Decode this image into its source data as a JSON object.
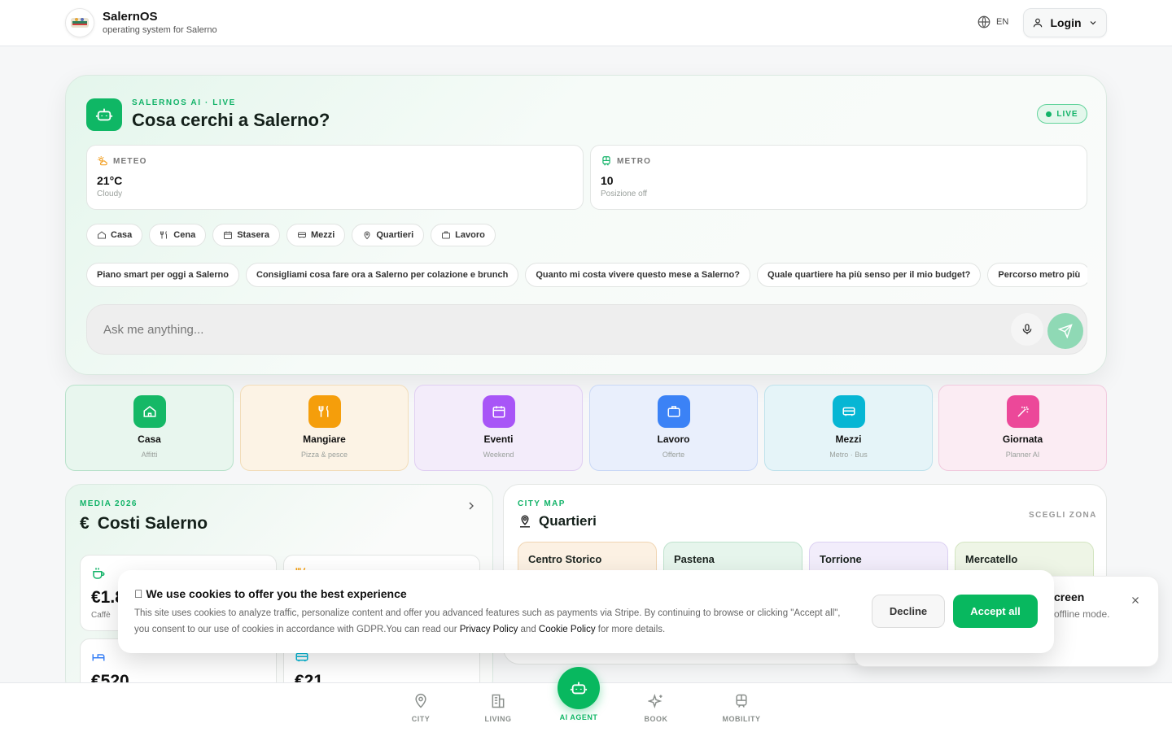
{
  "header": {
    "brand_name": "SalernOS",
    "brand_sub": "operating system for Salerno",
    "lang": "EN",
    "login_label": "Login"
  },
  "hero": {
    "kicker": "SALERNOS AI · LIVE",
    "title": "Cosa cerchi a Salerno?",
    "live_label": "LIVE",
    "weather": {
      "label": "METEO",
      "value": "21°C",
      "sub": "Cloudy"
    },
    "metro": {
      "label": "METRO",
      "value": "10",
      "sub": "Posizione off"
    },
    "chips": [
      "Casa",
      "Cena",
      "Stasera",
      "Mezzi",
      "Quartieri",
      "Lavoro"
    ],
    "suggestions": [
      "Piano smart per oggi a Salerno",
      "Consigliami cosa fare ora a Salerno per colazione e brunch",
      "Quanto mi costa vivere questo mese a Salerno?",
      "Quale quartiere ha più senso per il mio budget?",
      "Percorso metro più"
    ],
    "ask_placeholder": "Ask me anything..."
  },
  "categories": [
    {
      "title": "Casa",
      "sub": "Affitti",
      "bg": "#e8f6ee",
      "border": "#b9e2cb",
      "icon_bg": "#15b866",
      "icon": "home-icon"
    },
    {
      "title": "Mangiare",
      "sub": "Pizza & pesce",
      "bg": "#fcf3e5",
      "border": "#f2ddba",
      "icon_bg": "#f59e0b",
      "icon": "utensils-icon"
    },
    {
      "title": "Eventi",
      "sub": "Weekend",
      "bg": "#f3ecfa",
      "border": "#e0cff2",
      "icon_bg": "#a855f7",
      "icon": "calendar-icon"
    },
    {
      "title": "Lavoro",
      "sub": "Offerte",
      "bg": "#e9effc",
      "border": "#c9d8f6",
      "icon_bg": "#3b82f6",
      "icon": "briefcase-icon"
    },
    {
      "title": "Mezzi",
      "sub": "Metro · Bus",
      "bg": "#e5f4f8",
      "border": "#bfe2ec",
      "icon_bg": "#06b6d4",
      "icon": "bus-icon"
    },
    {
      "title": "Giornata",
      "sub": "Planner AI",
      "bg": "#fbecf3",
      "border": "#f1cade",
      "icon_bg": "#ec4899",
      "icon": "magic-wand-icon"
    }
  ],
  "costs": {
    "kicker": "MEDIA 2026",
    "title": "Costi Salerno",
    "cards": [
      {
        "value": "€1.8",
        "label": "Caffè"
      },
      {
        "value": "",
        "label": ""
      },
      {
        "value": "€520",
        "label": ""
      },
      {
        "value": "€21",
        "label": ""
      }
    ]
  },
  "map": {
    "kicker": "CITY MAP",
    "title": "Quartieri",
    "zone_label": "SCEGLI ZONA",
    "quarters": [
      {
        "name": "Centro Storico",
        "bg": "#fcf1e3",
        "border": "#f0d5b3"
      },
      {
        "name": "Pastena",
        "bg": "#e6f5ec",
        "border": "#bfe2cd"
      },
      {
        "name": "Torrione",
        "bg": "#f2edfb",
        "border": "#dcd0f2"
      },
      {
        "name": "Mercatello",
        "bg": "#eef5e6",
        "border": "#d3e5c1"
      }
    ]
  },
  "toast": {
    "title": "creen",
    "sub": "offline mode."
  },
  "cookie": {
    "title": "􏰀 We use cookies to offer you the best experience",
    "body_1": "This site uses cookies to analyze traffic, personalize content and offer you advanced features such as payments via Stripe. By continuing to browse or clicking \"Accept all\", you consent to our use of cookies in accordance with GDPR.You can read our ",
    "privacy": "Privacy Policy",
    "and": " and ",
    "cookie_policy": "Cookie Policy",
    "body_2": " for more details.",
    "decline": "Decline",
    "accept": "Accept all"
  },
  "nav": {
    "city": "CITY",
    "living": "LIVING",
    "ai": "AI AGENT",
    "book": "BOOK",
    "mobility": "MOBILITY"
  },
  "colors": {
    "accent": "#08b85f",
    "accent_light": "#12b368"
  }
}
